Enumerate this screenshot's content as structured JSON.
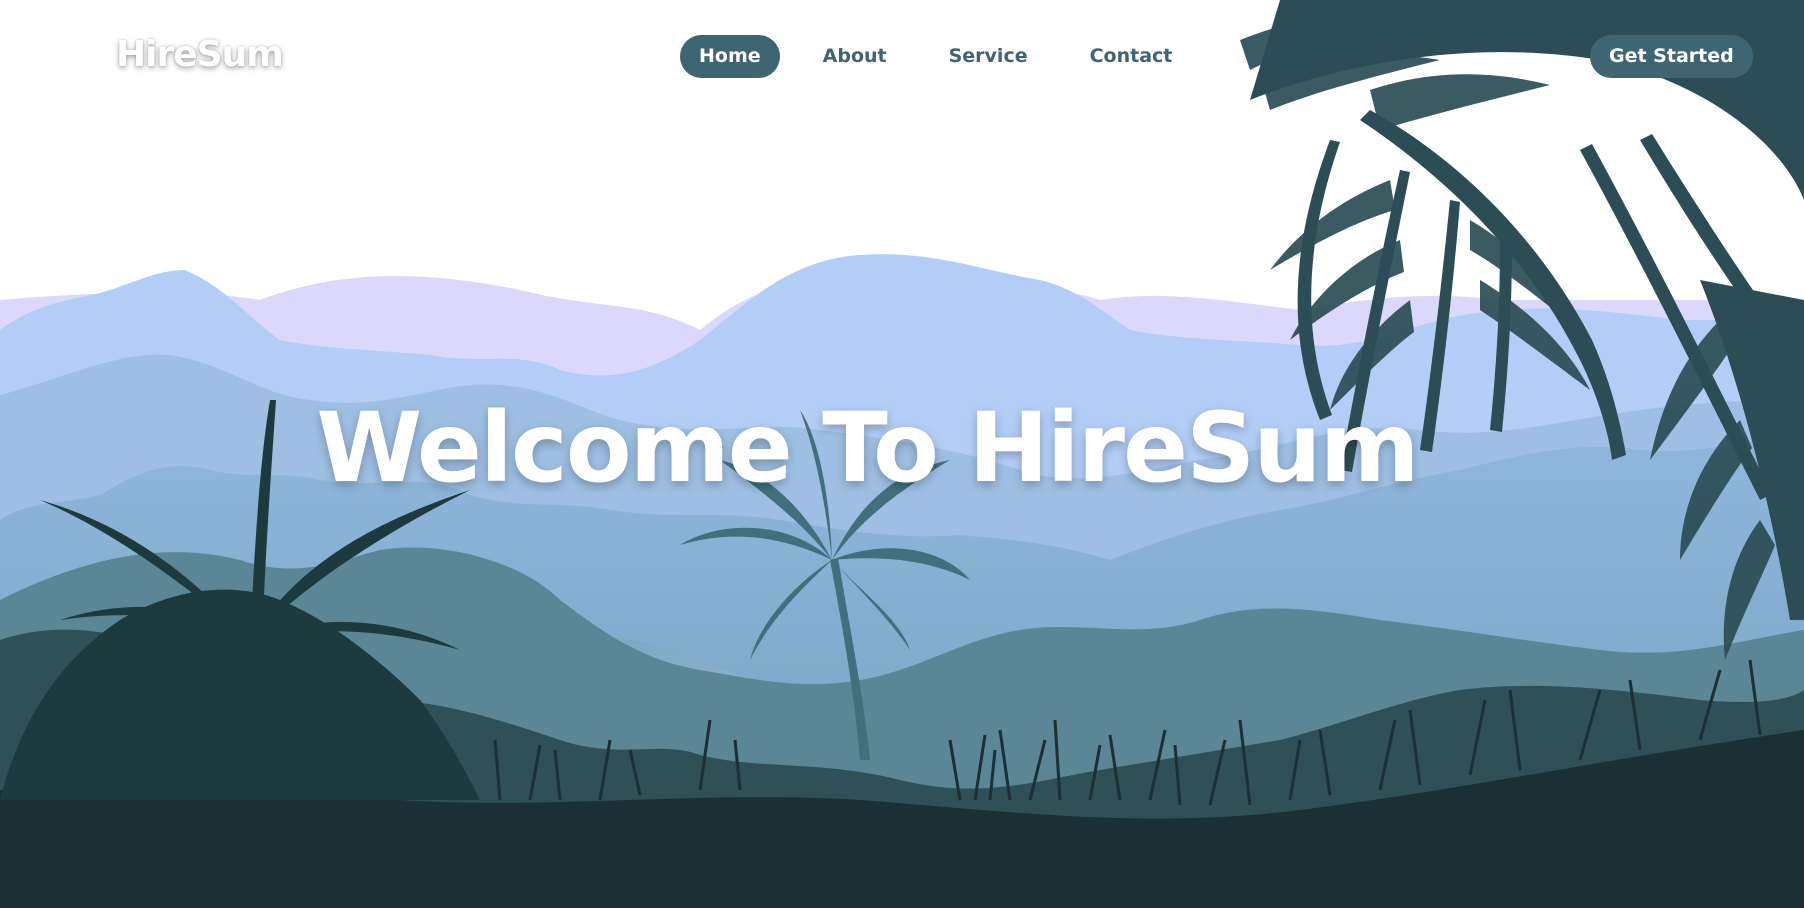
{
  "brand": {
    "logo_text": "HireSum"
  },
  "nav": {
    "items": [
      {
        "label": "Home",
        "active": true
      },
      {
        "label": "About",
        "active": false
      },
      {
        "label": "Service",
        "active": false
      },
      {
        "label": "Contact",
        "active": false
      }
    ],
    "cta_label": "Get Started"
  },
  "hero": {
    "title": "Welcome To HireSum"
  },
  "colors": {
    "accent": "#3f6573",
    "mountain_far": "#dcd8fb",
    "mountain_mid": "#b3cdf7",
    "forest_dark": "#1b3035"
  }
}
